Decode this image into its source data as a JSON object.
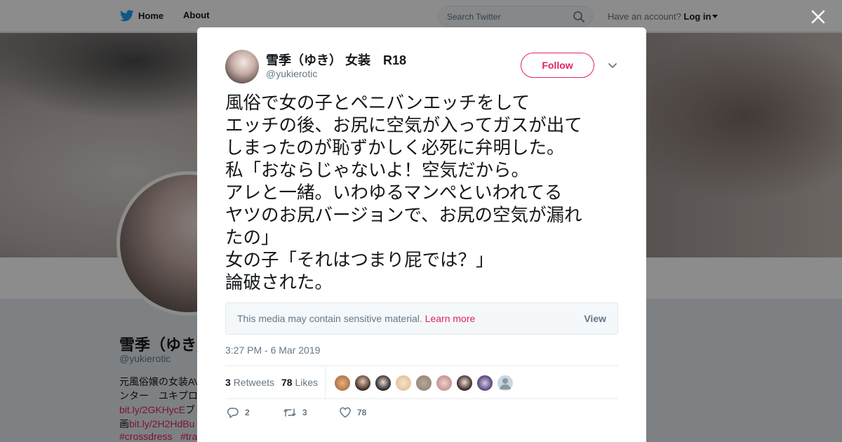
{
  "nav": {
    "home_label": "Home",
    "about_label": "About",
    "search_placeholder": "Search Twitter",
    "account_prompt": "Have an account?",
    "login_label": "Log in"
  },
  "background_profile": {
    "name": "雪季（ゆき）",
    "handle": "@yukierotic",
    "bio_line1": "元風俗嬢の女装AV",
    "bio_line2": "ンター　ユキプロ",
    "bio_line3_link": "bit.ly/2GKHycE",
    "bio_line3_text": "ブ",
    "bio_line4_prefix": "画",
    "bio_line4_link": "bit.ly/2H2HdBu",
    "bio_line5_tag1": "#crossdress",
    "bio_line5_tag2": "#tra"
  },
  "tweet": {
    "author_name": "雪季（ゆき） 女装　R18",
    "author_handle": "@yukierotic",
    "follow_label": "Follow",
    "text_lines": [
      "風俗で女の子とペニバンエッチをして",
      "エッチの後、お尻に空気が入ってガスが出て",
      "しまったのが恥ずかしく必死に弁明した。",
      "私「おならじゃないよ！空気だから。",
      "アレと一緒。いわゆるマンぺといわれてる",
      "ヤツのお尻バージョンで、お尻の空気が漏れ",
      "たの」",
      "女の子「それはつまり屁では？」",
      "論破された。"
    ],
    "media_warning": "This media may contain sensitive material.",
    "media_learn_more": "Learn more",
    "media_view": "View",
    "timestamp": "3:27 PM - 6 Mar 2019",
    "retweets_count": "3",
    "retweets_label": "Retweets",
    "likes_count": "78",
    "likes_label": "Likes",
    "reply_count": "2",
    "retweet_action_count": "3",
    "like_action_count": "78"
  },
  "colors": {
    "accent": "#e0245e",
    "twitter_blue": "#1da1f2",
    "muted_text": "#657786"
  },
  "icons": [
    "twitter-bird-icon",
    "home-icon",
    "search-icon",
    "close-icon",
    "chevron-down-icon",
    "reply-icon",
    "retweet-icon",
    "heart-icon"
  ]
}
